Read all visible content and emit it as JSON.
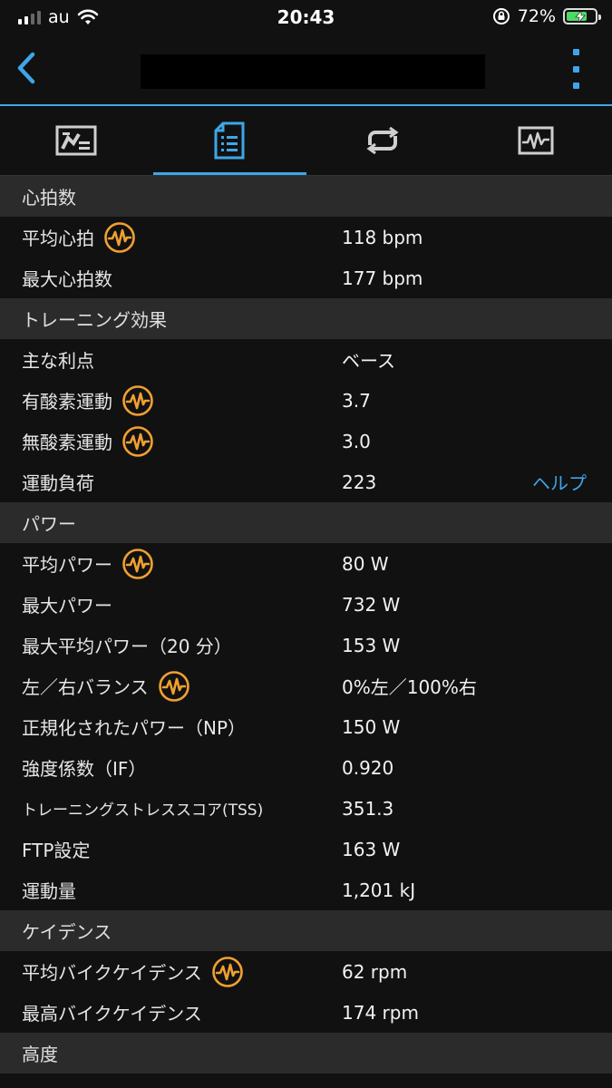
{
  "status_bar": {
    "carrier": "au",
    "time": "20:43",
    "battery_percent": "72%",
    "battery_level": 0.72
  },
  "tabs": [
    {
      "icon": "overview-map-icon",
      "active": false
    },
    {
      "icon": "stats-list-icon",
      "active": true
    },
    {
      "icon": "laps-icon",
      "active": false
    },
    {
      "icon": "chart-icon",
      "active": false
    }
  ],
  "sections": {
    "heart_rate": {
      "title": "心拍数",
      "avg_label": "平均心拍",
      "avg_value": "118 bpm",
      "max_label": "最大心拍数",
      "max_value": "177 bpm"
    },
    "training_effect": {
      "title": "トレーニング効果",
      "primary_label": "主な利点",
      "primary_value": "ベース",
      "aerobic_label": "有酸素運動",
      "aerobic_value": "3.7",
      "anaerobic_label": "無酸素運動",
      "anaerobic_value": "3.0",
      "load_label": "運動負荷",
      "load_value": "223",
      "help_label": "ヘルプ"
    },
    "power": {
      "title": "パワー",
      "avg_label": "平均パワー",
      "avg_value": "80 W",
      "max_label": "最大パワー",
      "max_value": "732 W",
      "max20_label": "最大平均パワー（20 分）",
      "max20_value": "153 W",
      "balance_label": "左／右バランス",
      "balance_value": "0%左／100%右",
      "np_label": "正規化されたパワー（NP）",
      "np_value": "150 W",
      "if_label": "強度係数（IF）",
      "if_value": "0.920",
      "tss_label": "トレーニングストレススコア(TSS)",
      "tss_value": "351.3",
      "ftp_label": "FTP設定",
      "ftp_value": "163 W",
      "work_label": "運動量",
      "work_value": "1,201 kJ"
    },
    "cadence": {
      "title": "ケイデンス",
      "avg_label": "平均バイクケイデンス",
      "avg_value": "62 rpm",
      "max_label": "最高バイクケイデンス",
      "max_value": "174 rpm"
    },
    "elevation": {
      "title": "高度"
    }
  },
  "colors": {
    "accent": "#3ea6e8",
    "insight_icon": "#f0a030",
    "section_bg": "#2b2b2b",
    "background": "#111111"
  }
}
